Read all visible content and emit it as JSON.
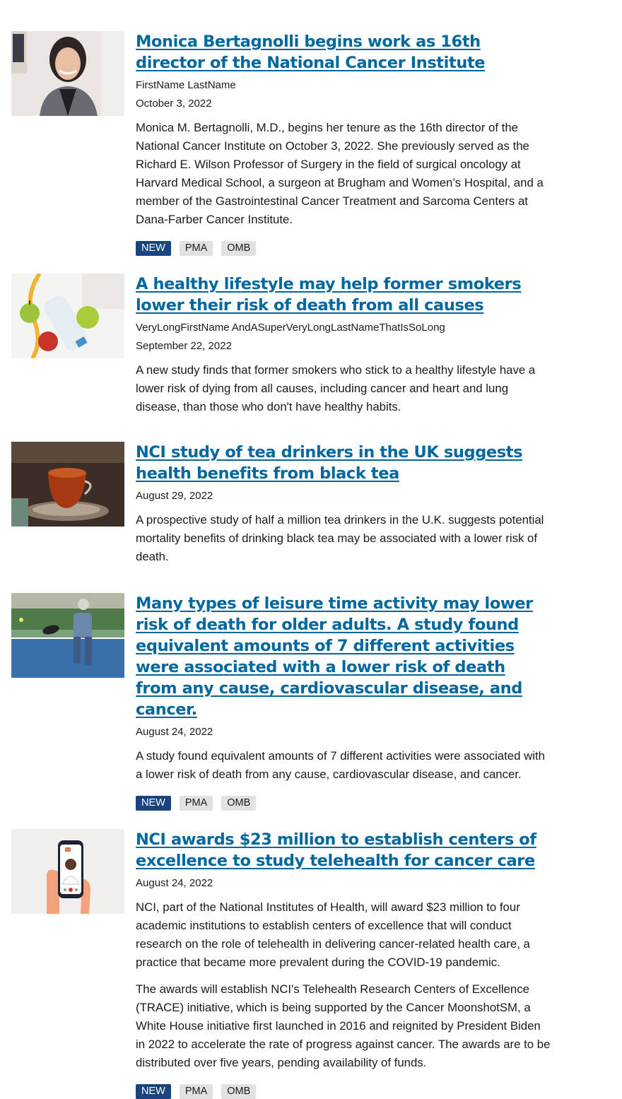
{
  "articles": [
    {
      "title": "Monica Bertagnolli begins work as 16th director of the National Cancer Institute",
      "author": "FirstName LastName",
      "date": "October 3, 2022",
      "paragraphs": [
        "Monica M. Bertagnolli, M.D., begins her tenure as the 16th director of the National Cancer Institute on October 3, 2022. She previously served as the Richard E. Wilson Professor of Surgery in the field of surgical oncology at Harvard Medical School, a surgeon at Brugham and Women’s Hospital, and a member of the Gastrointestinal Cancer Treatment and Sarcoma Centers at Dana-Farber Cancer Institute."
      ],
      "tags": [
        "NEW",
        "PMA",
        "OMB"
      ],
      "image": "portrait-photo"
    },
    {
      "title": "A healthy lifestyle may help former smokers lower their risk of death from all causes",
      "author": "VeryLongFirstName AndASuperVeryLongLastNameThatIsSoLong",
      "date": "September 22, 2022",
      "paragraphs": [
        "A new study finds that former smokers who stick to a healthy lifestyle have a lower risk of dying from all causes, including cancer and heart and lung disease, than those who don't have healthy habits."
      ],
      "tags": [],
      "image": "apples-water-photo"
    },
    {
      "title": "NCI study of tea drinkers in the UK suggests health benefits from black tea",
      "author": "",
      "date": "August 29, 2022",
      "paragraphs": [
        "A prospective study of half a million tea drinkers in the U.K. suggests potential mortality benefits of drinking black tea may be associated with a lower risk of death."
      ],
      "tags": [],
      "image": "black-tea-photo"
    },
    {
      "title": "Many types of leisure time activity may lower risk of death for older adults. A study found equivalent amounts of 7 different activities were associated with a lower risk of death from any cause, cardiovascular disease, and cancer.",
      "author": "",
      "date": "August 24, 2022",
      "paragraphs": [
        "A study found equivalent amounts of 7 different activities were associated with a lower risk of death from any cause, cardiovascular disease, and cancer."
      ],
      "tags": [
        "NEW",
        "PMA",
        "OMB"
      ],
      "image": "pickleball-photo"
    },
    {
      "title": "NCI awards $23 million to establish centers of excellence to study telehealth for cancer care",
      "author": "",
      "date": "August 24, 2022",
      "paragraphs": [
        "NCI, part of the National Institutes of Health, will award $23 million to four academic institutions to establish centers of excellence that will conduct research on the role of telehealth in delivering cancer-related health care, a practice that became more prevalent during the COVID-19 pandemic.",
        "The awards will establish NCI's Telehealth Research Centers of Excellence (TRACE) initiative, which is being supported by the Cancer MoonshotSM, a White House initiative first launched in 2016 and reignited by President Biden in 2022 to accelerate the rate of progress against cancer. The awards are to be distributed over five years, pending availability of funds."
      ],
      "tags": [
        "NEW",
        "PMA",
        "OMB"
      ],
      "image": "telehealth-illustration"
    }
  ]
}
